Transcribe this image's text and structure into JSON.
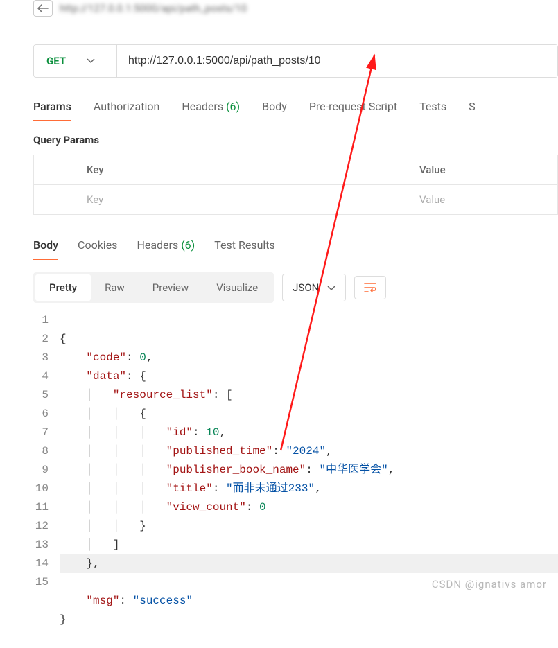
{
  "history": {
    "url_preview": "http://127.0.0.1:5000/api/path_posts/10"
  },
  "request": {
    "method": "GET",
    "url": "http://127.0.0.1:5000/api/path_posts/10"
  },
  "req_tabs": {
    "params": "Params",
    "auth": "Authorization",
    "headers": "Headers",
    "headers_count": "(6)",
    "body": "Body",
    "prerequest": "Pre-request Script",
    "tests": "Tests",
    "settings": "S"
  },
  "query_params": {
    "title": "Query Params",
    "key_header": "Key",
    "value_header": "Value",
    "key_placeholder": "Key",
    "value_placeholder": "Value"
  },
  "resp_tabs": {
    "body": "Body",
    "cookies": "Cookies",
    "headers": "Headers",
    "headers_count": "(6)",
    "test_results": "Test Results"
  },
  "view_tabs": {
    "pretty": "Pretty",
    "raw": "Raw",
    "preview": "Preview",
    "visualize": "Visualize"
  },
  "format_select": "JSON",
  "code": {
    "l1": "{",
    "l2_k": "\"code\"",
    "l2_v": "0",
    "l3_k": "\"data\"",
    "l4_k": "\"resource_list\"",
    "l6_k": "\"id\"",
    "l6_v": "10",
    "l7_k": "\"published_time\"",
    "l7_v": "\"2024\"",
    "l8_k": "\"publisher_book_name\"",
    "l8_v": "\"中华医学会\"",
    "l9_k": "\"title\"",
    "l9_v": "\"而非未通过233\"",
    "l10_k": "\"view_count\"",
    "l10_v": "0",
    "l14_k": "\"msg\"",
    "l14_v": "\"success\""
  },
  "watermark": "CSDN @ignativs  amor",
  "line_numbers": [
    "1",
    "2",
    "3",
    "4",
    "5",
    "6",
    "7",
    "8",
    "9",
    "10",
    "11",
    "12",
    "13",
    "14",
    "15"
  ]
}
